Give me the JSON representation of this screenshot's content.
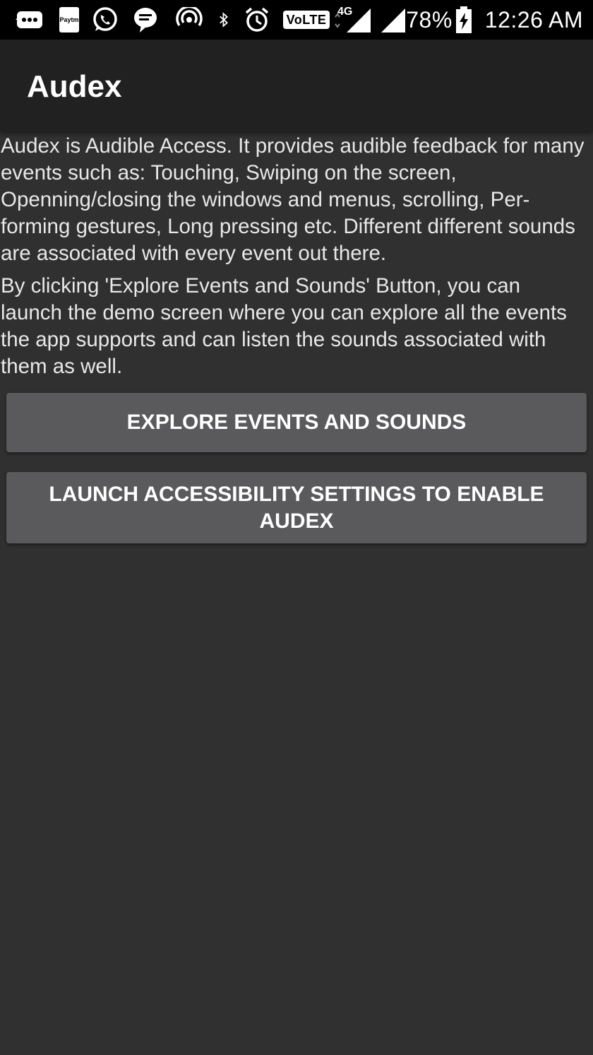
{
  "status_bar": {
    "icons": [
      "message-dots-icon",
      "paytm-icon",
      "whatsapp-icon",
      "chat-bubble-icon",
      "hotspot-icon",
      "bluetooth-icon",
      "alarm-icon",
      "volte-icon",
      "network-4g-icon",
      "signal-icon"
    ],
    "paytm_label": "Paytm",
    "volte_label": "VoLTE",
    "network_label": "4G",
    "battery": "78%",
    "time": "12:26 AM"
  },
  "app_bar": {
    "title": "Audex"
  },
  "content": {
    "paragraph_1": "Audex is Audible Access. It provides audible feedback for many events such as: Touching, Swiping on the screen, Openning/closing the windows and menus, scrolling, Per-forming gestures, Long pressing etc. Different different sounds are associated with every event out there.",
    "paragraph_2": "By clicking 'Explore Events and Sounds' Button, you can launch the demo screen where you can explore all the events the app supports and can listen the sounds associated with them as well."
  },
  "buttons": {
    "explore_label": "EXPLORE EVENTS AND SOUNDS",
    "launch_label": "LAUNCH ACCESSIBILITY SETTINGS TO ENABLE AUDEX"
  },
  "colors": {
    "status_bar_bg": "#000000",
    "app_bar_bg": "#212121",
    "background": "#303030",
    "button_bg": "#5a5a5c",
    "text": "#ffffff"
  }
}
